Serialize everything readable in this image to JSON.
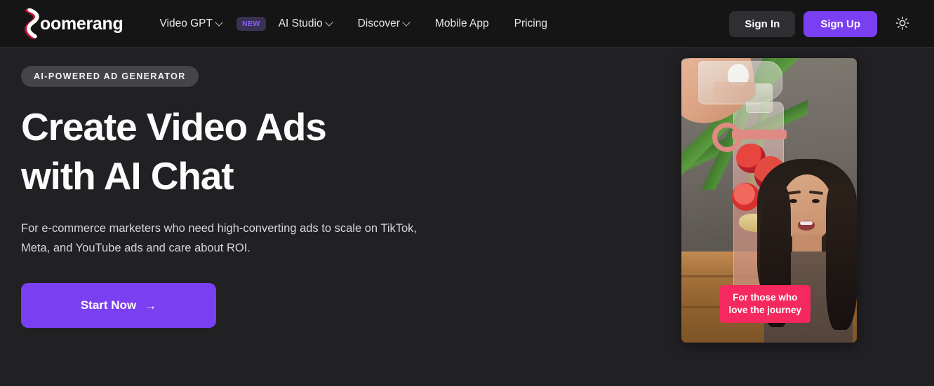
{
  "brand": {
    "name": "oomerang",
    "logo_icon": "boomerang-swoosh-logo",
    "logo_colors": {
      "swoosh_white": "#ffffff",
      "swoosh_red": "#c8102e"
    }
  },
  "header": {
    "nav": [
      {
        "label": "Video GPT",
        "has_chevron": true,
        "badge": "NEW"
      },
      {
        "label": "AI Studio",
        "has_chevron": true,
        "badge": null
      },
      {
        "label": "Discover",
        "has_chevron": true,
        "badge": null
      },
      {
        "label": "Mobile App",
        "has_chevron": false,
        "badge": null
      },
      {
        "label": "Pricing",
        "has_chevron": false,
        "badge": null
      }
    ],
    "sign_in_label": "Sign In",
    "sign_up_label": "Sign Up",
    "theme_toggle_icon": "sun-icon",
    "colors": {
      "background": "#151516",
      "sign_in_bg": "#2e2e33",
      "sign_up_bg": "#7b3ff2",
      "badge_bg": "#393252",
      "badge_text": "#8b5cf6"
    }
  },
  "hero": {
    "eyebrow_badge": "AI-POWERED AD GENERATOR",
    "title_line_1": "Create Video Ads",
    "title_line_2": "with AI Chat",
    "subtitle": "For e-commerce marketers who need high-converting ads to scale on TikTok, Meta, and YouTube ads and care about ROI.",
    "cta_label": "Start Now",
    "cta_arrow": "→",
    "colors": {
      "page_background": "#212124",
      "pill_bg": "#44444a",
      "title": "#fbfbfd",
      "cta_bg": "#7b3ff2"
    }
  },
  "video_preview": {
    "caption": "For those who\nlove the journey",
    "caption_bg": "#f5295e",
    "caption_text_color": "#ffffff",
    "scene_description": "Strawberry smoothie being poured into a glass bottle on a wooden table, woman speaking, plants in background"
  }
}
